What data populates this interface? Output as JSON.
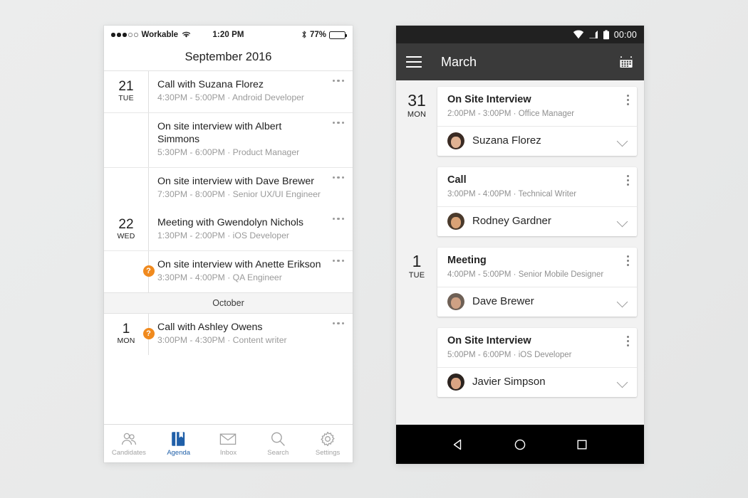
{
  "ios": {
    "status": {
      "carrier": "Workable",
      "signal_filled": 3,
      "signal_empty": 2,
      "wifi_icon": "wifi-icon",
      "time": "1:20 PM",
      "bluetooth_icon": "bluetooth-icon",
      "battery_percent": "77%",
      "battery_level": 77
    },
    "navbar": {
      "title": "September 2016"
    },
    "groups": [
      {
        "day_number": "21",
        "day_name": "TUE",
        "events": [
          {
            "title": "Call with Suzana Florez",
            "subtitle": "4:30PM - 5:00PM · Android Developer",
            "warning": false,
            "menu_icon": "more-horizontal-icon"
          },
          {
            "title": "On site interview with Albert Simmons",
            "subtitle": "5:30PM - 6:00PM · Product Manager",
            "warning": false,
            "menu_icon": "more-horizontal-icon"
          },
          {
            "title": "On site interview with Dave Brewer",
            "subtitle": "7:30PM - 8:00PM · Senior UX/UI Engineer",
            "warning": false,
            "menu_icon": "more-horizontal-icon"
          }
        ]
      },
      {
        "day_number": "22",
        "day_name": "WED",
        "events": [
          {
            "title": "Meeting with Gwendolyn Nichols",
            "subtitle": "1:30PM - 2:00PM · iOS Developer",
            "warning": false,
            "menu_icon": "more-horizontal-icon"
          },
          {
            "title": "On site interview with Anette Erikson",
            "subtitle": "3:30PM - 4:00PM · QA Engineer",
            "warning": true,
            "warning_badge": "?",
            "menu_icon": "more-horizontal-icon"
          }
        ]
      }
    ],
    "month_separator": "October",
    "groups_after": [
      {
        "day_number": "1",
        "day_name": "MON",
        "events": [
          {
            "title": "Call with Ashley Owens",
            "subtitle": "3:00PM - 4:30PM · Content writer",
            "warning": true,
            "warning_badge": "?",
            "menu_icon": "more-horizontal-icon"
          }
        ]
      }
    ],
    "tabs": [
      {
        "label": "Candidates",
        "icon": "people-icon",
        "active": false
      },
      {
        "label": "Agenda",
        "icon": "agenda-book-icon",
        "active": true
      },
      {
        "label": "Inbox",
        "icon": "envelope-icon",
        "active": false
      },
      {
        "label": "Search",
        "icon": "search-icon",
        "active": false
      },
      {
        "label": "Settings",
        "icon": "gear-icon",
        "active": false
      }
    ],
    "accent_color": "#1f5fa8",
    "warning_color": "#f08a1e"
  },
  "android": {
    "status": {
      "wifi_icon": "wifi-icon",
      "signal_icon": "cell-signal-icon",
      "battery_icon": "battery-full-icon",
      "clock": "00:00"
    },
    "appbar": {
      "menu_icon": "hamburger-menu-icon",
      "title": "March",
      "calendar_icon": "calendar-icon"
    },
    "groups": [
      {
        "day_number": "31",
        "day_name": "MON",
        "cards": [
          {
            "title": "On Site Interview",
            "subtitle": "2:00PM - 3:00PM  ·  Office Manager",
            "person": "Suzana Florez",
            "avatar_icon": "avatar",
            "menu_icon": "more-vertical-icon",
            "expand_icon": "chevron-down-icon",
            "avatar_hair": "#3a2b24",
            "avatar_skin": "#e0b293"
          },
          {
            "title": "Call",
            "subtitle": "3:00PM - 4:00PM  ·  Technical Writer",
            "person": "Rodney Gardner",
            "avatar_icon": "avatar",
            "menu_icon": "more-vertical-icon",
            "expand_icon": "chevron-down-icon",
            "avatar_hair": "#4a3a2c",
            "avatar_skin": "#d9a276"
          }
        ]
      },
      {
        "day_number": "1",
        "day_name": "TUE",
        "cards": [
          {
            "title": "Meeting",
            "subtitle": "4:00PM - 5:00PM  ·  Senior Mobile Designer",
            "person": "Dave Brewer",
            "avatar_icon": "avatar",
            "menu_icon": "more-vertical-icon",
            "expand_icon": "chevron-down-icon",
            "avatar_hair": "#6e6056",
            "avatar_skin": "#cfa184"
          },
          {
            "title": "On Site Interview",
            "subtitle": "5:00PM - 6:00PM  ·  iOS Developer",
            "person": "Javier Simpson",
            "avatar_icon": "avatar",
            "menu_icon": "more-vertical-icon",
            "expand_icon": "chevron-down-icon",
            "avatar_hair": "#2c2420",
            "avatar_skin": "#d9a483"
          }
        ]
      }
    ],
    "navbar": [
      {
        "icon": "back-triangle-icon",
        "name": "back-button"
      },
      {
        "icon": "home-circle-icon",
        "name": "home-button"
      },
      {
        "icon": "recents-square-icon",
        "name": "recents-button"
      }
    ]
  }
}
